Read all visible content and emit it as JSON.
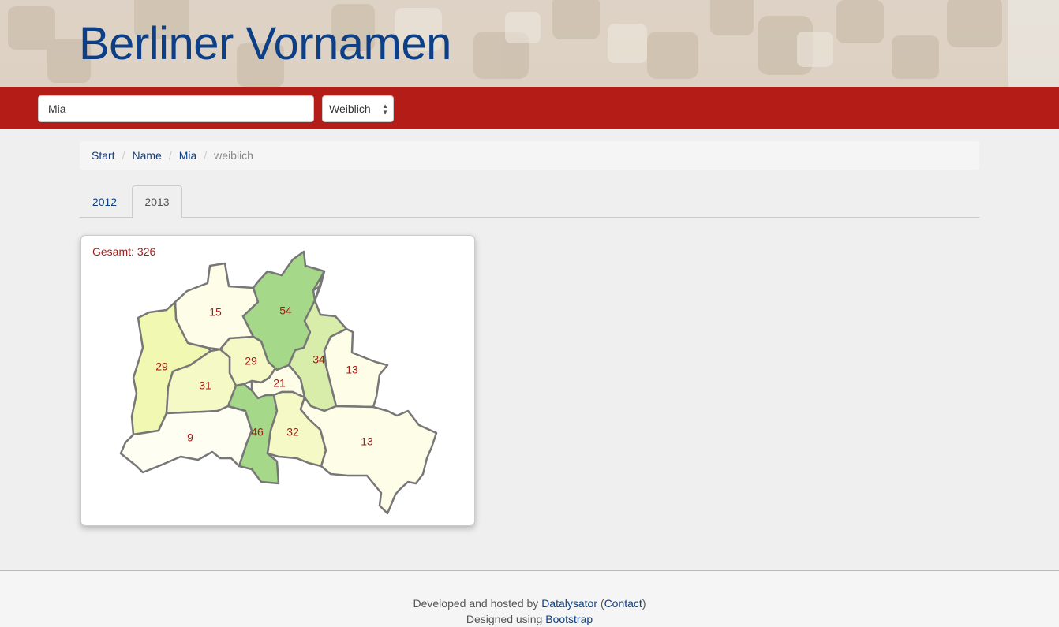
{
  "header": {
    "title": "Berliner Vornamen"
  },
  "search": {
    "value": "Mia"
  },
  "gender_select": {
    "selected": "Weiblich"
  },
  "breadcrumb": {
    "items": [
      "Start",
      "Name",
      "Mia"
    ],
    "active": "weiblich"
  },
  "tabs": [
    {
      "label": "2012",
      "active": false
    },
    {
      "label": "2013",
      "active": true
    }
  ],
  "map": {
    "total_label": "Gesamt:",
    "total_value": "326",
    "districts": [
      {
        "value": "15",
        "color": "#fdfde8"
      },
      {
        "value": "54",
        "color": "#a6d88a"
      },
      {
        "value": "29",
        "color": "#f1f8b2"
      },
      {
        "value": "29",
        "color": "#f5f9c6"
      },
      {
        "value": "34",
        "color": "#d8edaa"
      },
      {
        "value": "13",
        "color": "#fdfde8"
      },
      {
        "value": "31",
        "color": "#f5f9c6"
      },
      {
        "value": "21",
        "color": "#fdfde8"
      },
      {
        "value": "9",
        "color": "#fefef2"
      },
      {
        "value": "46",
        "color": "#a6d88a"
      },
      {
        "value": "32",
        "color": "#f5f9c6"
      },
      {
        "value": "13",
        "color": "#fdfde8"
      }
    ]
  },
  "footer": {
    "line1_prefix": "Developed and hosted by",
    "line1_link": "Datalysator",
    "line1_contact": "Contact",
    "line2_prefix": "Designed using",
    "line2_link": "Bootstrap"
  },
  "colors": {
    "brand_red": "#b41c17",
    "title_blue": "#0d3f86",
    "label_red": "#a51c18"
  }
}
